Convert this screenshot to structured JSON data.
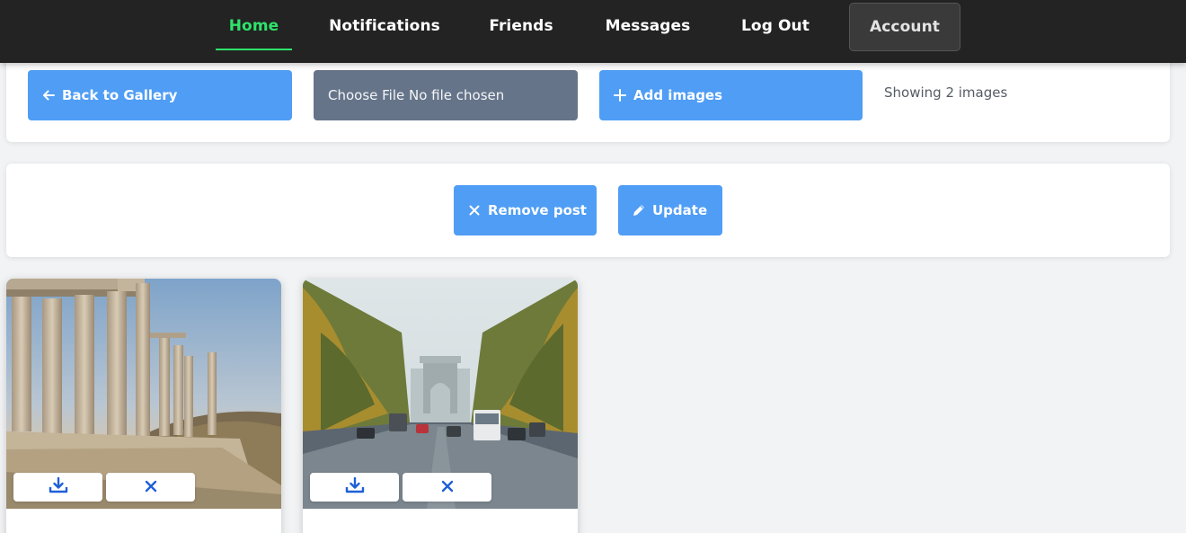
{
  "nav": {
    "items": [
      {
        "label": "Home",
        "active": true
      },
      {
        "label": "Notifications"
      },
      {
        "label": "Friends"
      },
      {
        "label": "Messages"
      },
      {
        "label": "Log Out"
      },
      {
        "label": "Account"
      }
    ],
    "active_color": "#2ee36b"
  },
  "toolbar": {
    "back_label": "Back to Gallery",
    "file_input_label": "Choose File No file chosen",
    "add_images_label": "Add images",
    "showing_text": "Showing 2 images"
  },
  "actions": {
    "remove_label": "Remove post",
    "update_label": "Update"
  },
  "gallery": {
    "images": [
      {
        "subject": "ancient temple ruins",
        "download_icon": "download-icon",
        "remove_icon": "close-icon"
      },
      {
        "subject": "tree-lined avenue with arch",
        "download_icon": "download-icon",
        "remove_icon": "close-icon"
      }
    ]
  },
  "colors": {
    "nav_bg": "#232323",
    "primary_button": "#4f9df5",
    "file_button": "#667489",
    "icon_blue": "#1f5fd6"
  }
}
